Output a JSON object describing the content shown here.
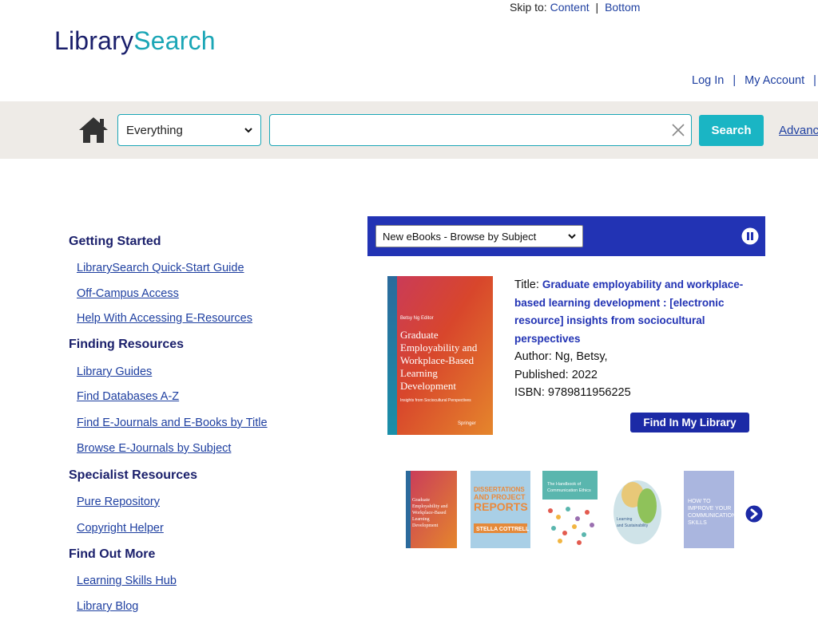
{
  "skip": {
    "label": "Skip to:",
    "content": "Content",
    "sep": "|",
    "bottom": "Bottom"
  },
  "logo": {
    "part1": "Library",
    "part2": "Search"
  },
  "account": {
    "login": "Log In",
    "sep": "|",
    "my_account": "My Account",
    "sep2": "|"
  },
  "search": {
    "scope_value": "Everything",
    "query_value": "",
    "button": "Search",
    "advanced": "Advanced"
  },
  "nav": {
    "getting_started": "Getting Started",
    "quick_start": "LibrarySearch Quick-Start Guide",
    "off_campus": "Off-Campus Access",
    "help_eresources": "Help With Accessing E-Resources",
    "finding_resources": "Finding Resources",
    "library_guides": "Library Guides",
    "databases": "Find Databases A-Z",
    "ejournals_title": "Find E-Journals and E-Books by Title",
    "browse_ejournals": "Browse E-Journals by Subject",
    "specialist": "Specialist Resources",
    "pure": "Pure Repository",
    "copyright": "Copyright Helper",
    "find_out_more": "Find Out More",
    "learning_skills": "Learning Skills Hub",
    "blog": "Library Blog"
  },
  "widget": {
    "select_value": "New eBooks - Browse by Subject",
    "title_label": "Title:",
    "title_value": "Graduate employability and workplace-based learning development : [electronic resource] insights from sociocultural perspectives",
    "author": "Author: Ng, Betsy,",
    "published": "Published: 2022",
    "isbn": "ISBN: 9789811956225",
    "find_button": "Find In My Library"
  },
  "cover_main": {
    "editor": "Betsy Ng  Editor",
    "title": "Graduate Employability and Workplace-Based Learning Development",
    "subtitle": "Insights from Sociocultural Perspectives",
    "publisher": "Springer"
  },
  "thumbs": [
    {
      "text1": "Graduate Employability and Workplace-Based Learning Development",
      "color": "#d8442c"
    },
    {
      "text1": "DISSERTATIONS AND PROJECT REPORTS",
      "text2": "STELLA COTTRELL",
      "color": "#9fc8e0"
    },
    {
      "text1": "The Handbook of Communication Ethics",
      "color": "#5fb8b0"
    },
    {
      "text1": "Learning and Sustainability",
      "color": "#dfe6e8"
    },
    {
      "text1": "HOW TO IMPROVE YOUR COMMUNICATION SKILLS",
      "color": "#a9b6de"
    }
  ],
  "colors": {
    "brand_dark": "#1a1f6b",
    "brand_teal": "#1ba6b6",
    "link": "#1e3fa0",
    "widget_blue": "#2233b4"
  },
  "icons": [
    "home-icon",
    "chevron-down-icon",
    "clear-icon",
    "pause-icon",
    "next-arrow-icon"
  ]
}
